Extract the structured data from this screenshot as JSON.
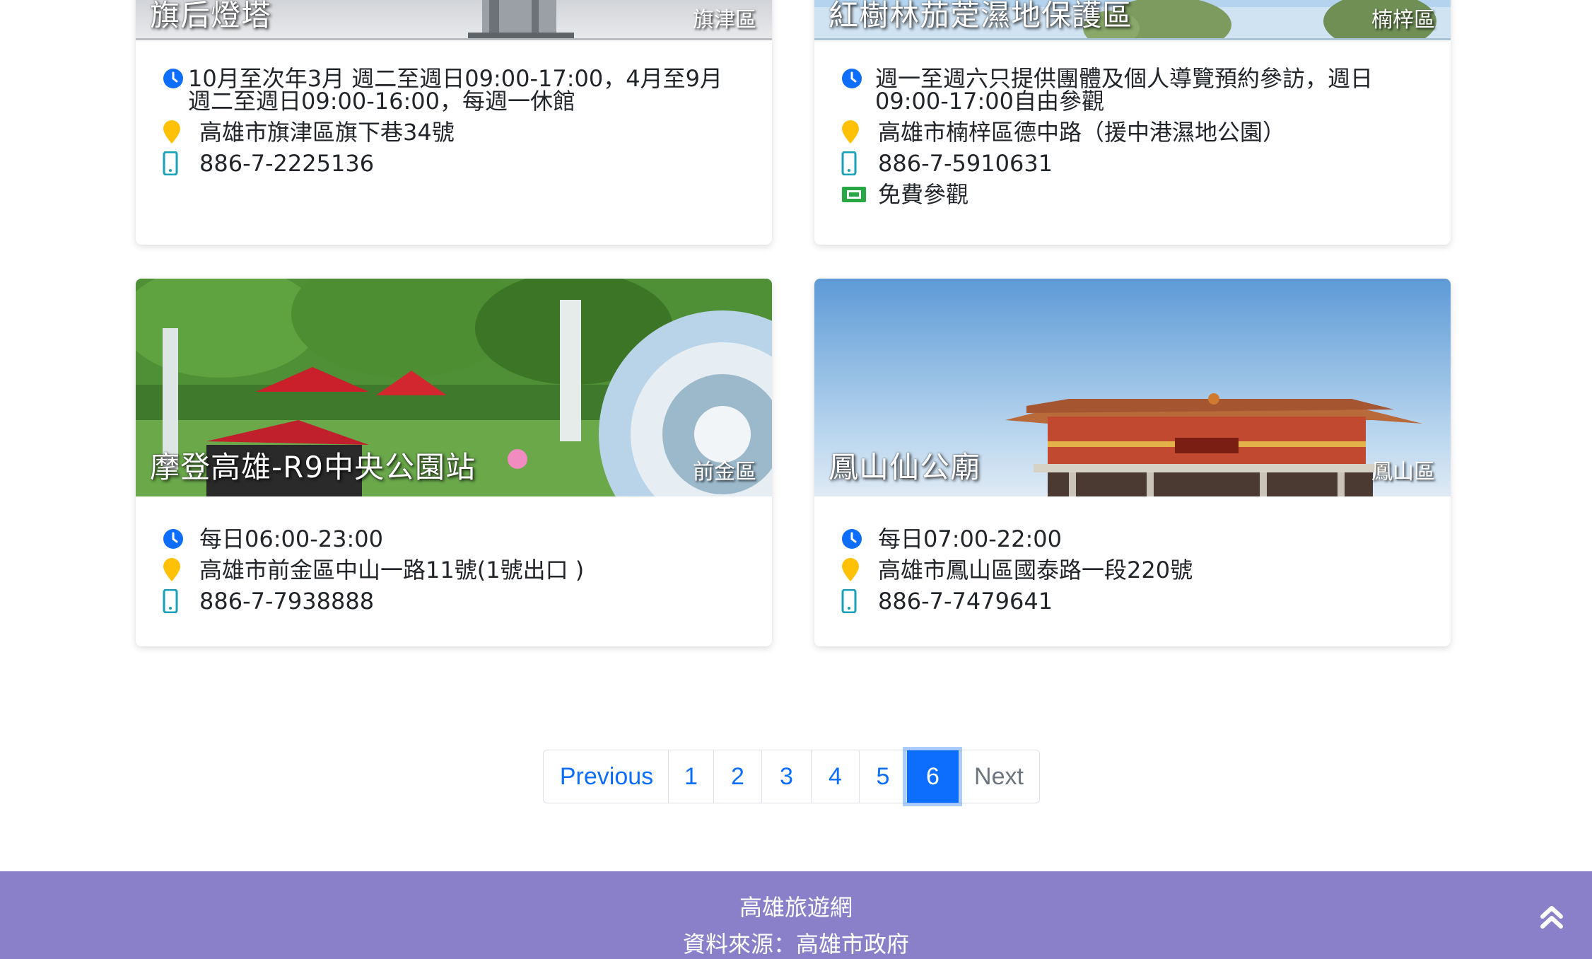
{
  "cards": [
    {
      "name": "旗后燈塔",
      "district": "旗津區",
      "hours": "10月至次年3月 週二至週日09:00-17:00，4月至9月 週二至週日09:00-16:00，每週一休館",
      "address": "高雄市旗津區旗下巷34號",
      "phone": "886-7-2225136"
    },
    {
      "name": "紅樹林茄萣濕地保護區",
      "district": "楠梓區",
      "hours": "週一至週六只提供團體及個人導覽預約參訪，週日09:00-17:00自由參觀",
      "address": "高雄市楠梓區德中路（援中港濕地公園）",
      "phone": "886-7-5910631",
      "ticket": "免費參觀"
    },
    {
      "name": "摩登高雄-R9中央公園站",
      "district": "前金區",
      "hours": "每日06:00-23:00",
      "address": "高雄市前金區中山一路11號(1號出口 )",
      "phone": "886-7-7938888"
    },
    {
      "name": "鳳山仙公廟",
      "district": "鳳山區",
      "hours": "每日07:00-22:00",
      "address": "高雄市鳳山區國泰路一段220號",
      "phone": "886-7-7479641"
    }
  ],
  "pagination": {
    "previous": "Previous",
    "pages": [
      "1",
      "2",
      "3",
      "4",
      "5",
      "6"
    ],
    "active": "6",
    "next": "Next"
  },
  "footer": {
    "title": "高雄旅遊網",
    "source": "資料來源：高雄市政府"
  },
  "icons": {
    "clock": "clock-icon",
    "location": "map-marker-icon",
    "phone": "mobile-phone-icon",
    "ticket": "ticket-icon",
    "to_top": "double-chevron-up-icon"
  },
  "colors": {
    "clock": "#0d6efd",
    "location": "#ffc107",
    "phone": "#17a2b8",
    "ticket": "#28a745",
    "footer_bg": "#8a7fc9",
    "active_page": "#0d6efd"
  }
}
